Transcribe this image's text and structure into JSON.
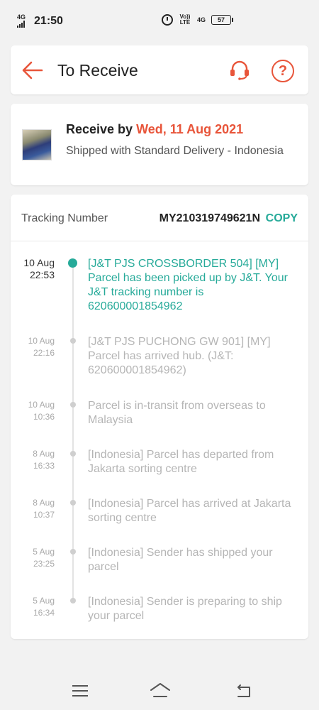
{
  "status_bar": {
    "network": "4G",
    "time": "21:50",
    "volte": "Vo)) LTE",
    "network_right": "4G",
    "battery": "57"
  },
  "header": {
    "title": "To Receive"
  },
  "summary": {
    "receive_prefix": "Receive by",
    "receive_date": "Wed, 11 Aug 2021",
    "shipping_text": "Shipped with Standard Delivery - Indonesia"
  },
  "tracking": {
    "label": "Tracking Number",
    "number": "MY210319749621N",
    "copy_label": "COPY",
    "events": [
      {
        "date": "10 Aug",
        "time": "22:53",
        "text": "[J&T PJS CROSSBORDER 504] [MY] Parcel has been picked up by J&T. Your J&T tracking number is 620600001854962"
      },
      {
        "date": "10 Aug",
        "time": "22:16",
        "text": "[J&T PJS PUCHONG GW 901] [MY] Parcel has arrived hub. (J&T: 620600001854962)"
      },
      {
        "date": "10 Aug",
        "time": "10:36",
        "text": "Parcel is in-transit from overseas to Malaysia"
      },
      {
        "date": "8 Aug",
        "time": "16:33",
        "text": "[Indonesia] Parcel has departed from Jakarta sorting centre"
      },
      {
        "date": "8 Aug",
        "time": "10:37",
        "text": "[Indonesia] Parcel has arrived at Jakarta sorting centre"
      },
      {
        "date": "5 Aug",
        "time": "23:25",
        "text": "[Indonesia] Sender has shipped your parcel"
      },
      {
        "date": "5 Aug",
        "time": "16:34",
        "text": "[Indonesia] Sender is preparing to ship your parcel"
      }
    ]
  },
  "colors": {
    "accent": "#e8553a",
    "teal": "#26aa99",
    "muted": "#b5b5b5"
  },
  "icons": {
    "back": "arrow-left-icon",
    "support": "headset-icon",
    "help": "question-icon"
  }
}
